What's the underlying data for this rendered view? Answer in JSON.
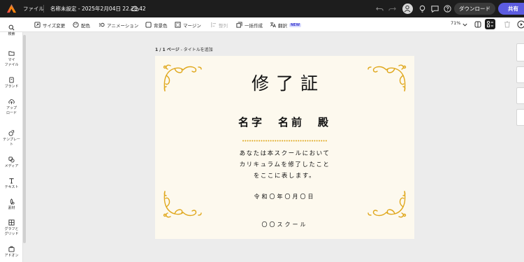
{
  "topbar": {
    "file_menu": "ファイル",
    "doc_title": "名称未設定 - 2025年2月04日 22.28.42",
    "download_label": "ダウンロード",
    "share_label": "共有"
  },
  "toolbar": {
    "resize": "サイズ変更",
    "colors": "配色",
    "animation": "アニメーション",
    "background": "背景色",
    "margin": "マージン",
    "arrange": "整列",
    "bulk_create": "一括作成",
    "translate": "翻訳",
    "new_badge": "NEW",
    "zoom": "71%"
  },
  "sidebar": {
    "items": [
      {
        "label": "検索",
        "icon": "search-icon"
      },
      {
        "label": "マイ\nファイル",
        "icon": "folder-icon"
      },
      {
        "label": "ブランド",
        "icon": "brand-icon"
      },
      {
        "label": "アップ\nロード",
        "icon": "upload-icon"
      },
      {
        "label": "テンプレー\nト",
        "icon": "template-icon"
      },
      {
        "label": "メディア",
        "icon": "media-icon"
      },
      {
        "label": "テキスト",
        "icon": "text-icon"
      },
      {
        "label": "素材",
        "icon": "elements-icon"
      },
      {
        "label": "グラフと\nグリッド",
        "icon": "chart-grid-icon"
      },
      {
        "label": "アドオン",
        "icon": "addon-icon"
      }
    ]
  },
  "page": {
    "page_number": "1 / 1 ページ",
    "add_title": " - タイトルを追加"
  },
  "certificate": {
    "title": "修了証",
    "name": "名字　名前　殿",
    "body_line1": "あなたは本スクールにおいて",
    "body_line2": "カリキュラムを修了したこと",
    "body_line3": "をここに表します。",
    "date": "令和〇年〇月〇日",
    "school": "〇〇スクール",
    "ornament_color": "#e0a81e",
    "background_color": "#fdf9ee"
  },
  "colors": {
    "topbar_bg": "#1d1d1d",
    "share_accent": "#5c5ce0",
    "canvas_bg": "#ececec"
  }
}
